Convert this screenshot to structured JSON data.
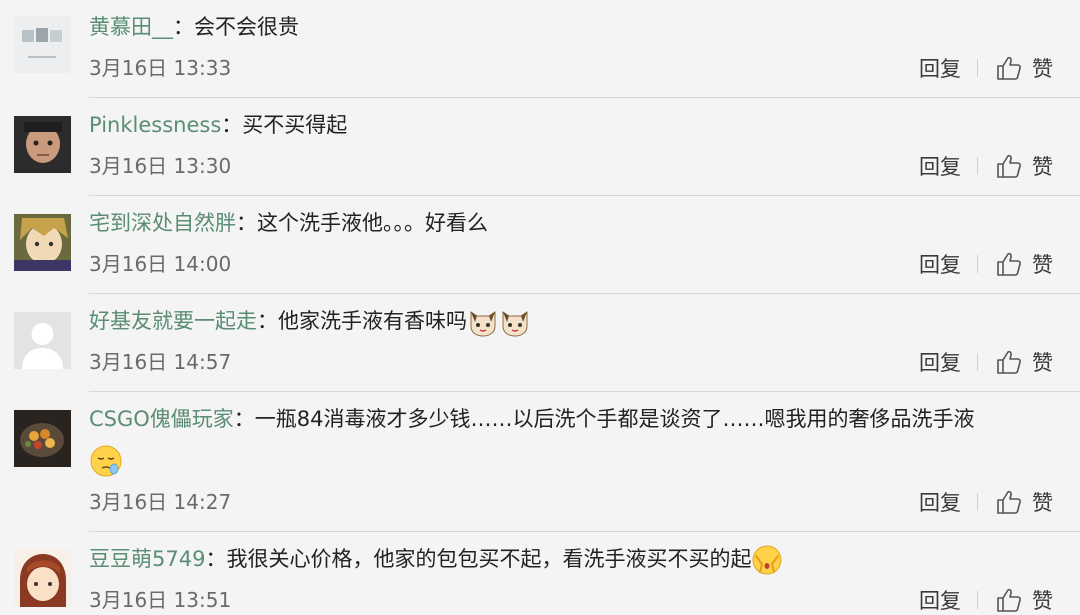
{
  "comments": [
    {
      "user": "黄慕田__",
      "colon": "：",
      "text": "会不会很贵",
      "time": "3月16日 13:33",
      "reply": "回复",
      "like": "赞",
      "avatar": "photo-avatar"
    },
    {
      "user": "Pinklessness",
      "colon": "：",
      "text": "买不买得起",
      "time": "3月16日 13:30",
      "reply": "回复",
      "like": "赞",
      "avatar": "face-avatar"
    },
    {
      "user": "宅到深处自然胖",
      "colon": "：",
      "text": "这个洗手液他。。。好看么",
      "time": "3月16日 14:00",
      "reply": "回复",
      "like": "赞",
      "avatar": "anime-avatar"
    },
    {
      "user": "好基友就要一起走",
      "colon": "：",
      "text": "他家洗手液有香味吗",
      "emojis": [
        "cat-face-emoji",
        "cat-face-emoji"
      ],
      "time": "3月16日 14:57",
      "reply": "回复",
      "like": "赞",
      "avatar": "default-avatar"
    },
    {
      "user": "CSGO傀儡玩家",
      "colon": "：",
      "text": "一瓶84消毒液才多少钱……以后洗个手都是谈资了……嗯我用的奢侈品洗手液",
      "emojis": [
        "sleepy-face-emoji"
      ],
      "time": "3月16日 14:27",
      "reply": "回复",
      "like": "赞",
      "avatar": "food-avatar"
    },
    {
      "user": "豆豆萌5749",
      "colon": "：",
      "text": "我很关心价格，他家的包包买不起，看洗手液买不买的起",
      "emojis": [
        "covering-face-emoji"
      ],
      "time": "3月16日 13:51",
      "reply": "回复",
      "like": "赞",
      "avatar": "cartoon-girl-avatar"
    }
  ]
}
